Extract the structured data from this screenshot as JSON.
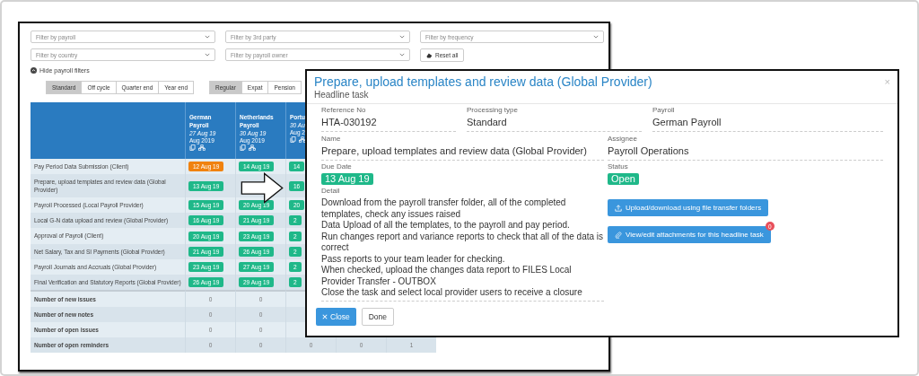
{
  "filters": [
    {
      "placeholder": "Filter by payroll"
    },
    {
      "placeholder": "Filter by 3rd party"
    },
    {
      "placeholder": "Filter by frequency"
    },
    {
      "placeholder": "Filter by country"
    },
    {
      "placeholder": "Filter by payroll owner"
    }
  ],
  "reset_button": "Reset all",
  "filter_toggle": "Hide payroll filters",
  "segment_groups": [
    [
      {
        "label": "Standard",
        "selected": true
      },
      {
        "label": "Off cycle",
        "selected": false
      },
      {
        "label": "Quarter end",
        "selected": false
      },
      {
        "label": "Year end",
        "selected": false
      }
    ],
    [
      {
        "label": "Regular",
        "selected": true
      },
      {
        "label": "Expat",
        "selected": false
      },
      {
        "label": "Pension",
        "selected": false
      }
    ]
  ],
  "table": {
    "columns": [
      {
        "name": "German Payroll",
        "date": "27 Aug 19",
        "period": "Aug 2019"
      },
      {
        "name": "Netherlands Payroll",
        "date": "30 Aug 19",
        "period": "Aug 2019"
      },
      {
        "name": "Portu",
        "date": "30 Au",
        "period": "Aug 2"
      }
    ],
    "rows": [
      {
        "task": "Pay Period Data Submission (Client)",
        "dates": [
          {
            "text": "12 Aug 19",
            "color": "#f0820f"
          },
          {
            "text": "14 Aug 19",
            "color": "#1fb889"
          },
          {
            "text": "14",
            "color": "#1fb889"
          }
        ]
      },
      {
        "task": "Prepare, upload templates and review data (Global Provider)",
        "dates": [
          {
            "kind": "badge",
            "text": "13 Aug 19",
            "color": "#1fb889"
          },
          {
            "kind": "covered"
          },
          {
            "kind": "badge",
            "text": "16",
            "color": "#1fb889"
          }
        ]
      },
      {
        "task": "Payroll Processed (Local Payroll Provider)",
        "dates": [
          {
            "text": "15 Aug 19",
            "color": "#1fb889"
          },
          {
            "text": "20 Aug 19",
            "color": "#1fb889"
          },
          {
            "text": "20",
            "color": "#1fb889"
          }
        ]
      },
      {
        "task": "Local G-N data upload and review (Global Provider)",
        "dates": [
          {
            "text": "16 Aug 19",
            "color": "#1fb889"
          },
          {
            "text": "21 Aug 19",
            "color": "#1fb889"
          },
          {
            "text": "2",
            "color": "#1fb889"
          }
        ]
      },
      {
        "task": "Approval of Payroll (Client)",
        "dates": [
          {
            "text": "20 Aug 19",
            "color": "#1fb889"
          },
          {
            "text": "23 Aug 19",
            "color": "#1fb889"
          },
          {
            "text": "2",
            "color": "#1fb889"
          }
        ]
      },
      {
        "task": "Net Salary, Tax and SI Payments (Global Provider)",
        "dates": [
          {
            "text": "21 Aug 19",
            "color": "#1fb889"
          },
          {
            "text": "26 Aug 19",
            "color": "#1fb889"
          },
          {
            "text": "2",
            "color": "#1fb889"
          }
        ]
      },
      {
        "task": "Payroll Journals and Accruals (Global Provider)",
        "dates": [
          {
            "text": "23 Aug 19",
            "color": "#1fb889"
          },
          {
            "text": "27 Aug 19",
            "color": "#1fb889"
          },
          {
            "text": "2",
            "color": "#1fb889"
          }
        ]
      },
      {
        "task": "Final Verification and Statutory Reports (Global Provider)",
        "dates": [
          {
            "text": "26 Aug 19",
            "color": "#1fb889"
          },
          {
            "text": "29 Aug 19",
            "color": "#1fb889"
          },
          {
            "text": "2",
            "color": "#1fb889"
          }
        ]
      }
    ],
    "summary": [
      {
        "label": "Number of new issues",
        "values": [
          "0",
          "0"
        ]
      },
      {
        "label": "Number of new notes",
        "values": [
          "0",
          "0"
        ]
      },
      {
        "label": "Number of open issues",
        "values": [
          "0",
          "0"
        ]
      },
      {
        "label": "Number of open reminders",
        "values": [
          "0",
          "0",
          "0",
          "0",
          "1"
        ]
      }
    ]
  },
  "modal": {
    "title": "Prepare, upload templates and review data (Global Provider)",
    "subtitle": "Headline task",
    "close_icon": "×",
    "top_fields": [
      {
        "label": "Reference No",
        "value": "HTA-030192"
      },
      {
        "label": "Processing type",
        "value": "Standard"
      },
      {
        "label": "Payroll",
        "value": "German Payroll"
      }
    ],
    "name": {
      "label": "Name",
      "value": "Prepare, upload templates and review data (Global Provider)"
    },
    "assignee": {
      "label": "Assignee",
      "value": "Payroll Operations"
    },
    "due_date": {
      "label": "Due Date",
      "value": "13 Aug 19"
    },
    "status": {
      "label": "Status",
      "value": "Open"
    },
    "detail": {
      "label": "Detail",
      "value": "Download from the payroll transfer folder, all of the completed templates, check any issues raised\nData Upload of all the templates, to the payroll and pay period.\nRun changes report and variance reports to check that all of the data is correct\nPass reports to your team leader for checking.\nWhen checked, upload the changes data report to FILES Local Provider Transfer - OUTBOX\nClose the task and select local provider users to receive a closure"
    },
    "actions": [
      {
        "label": "Upload/download using file transfer folders",
        "kind": "upload"
      },
      {
        "label": "View/edit attachments for this headline task",
        "kind": "attach",
        "badge": "0"
      }
    ],
    "close_button": "Close",
    "done_button": "Done"
  }
}
